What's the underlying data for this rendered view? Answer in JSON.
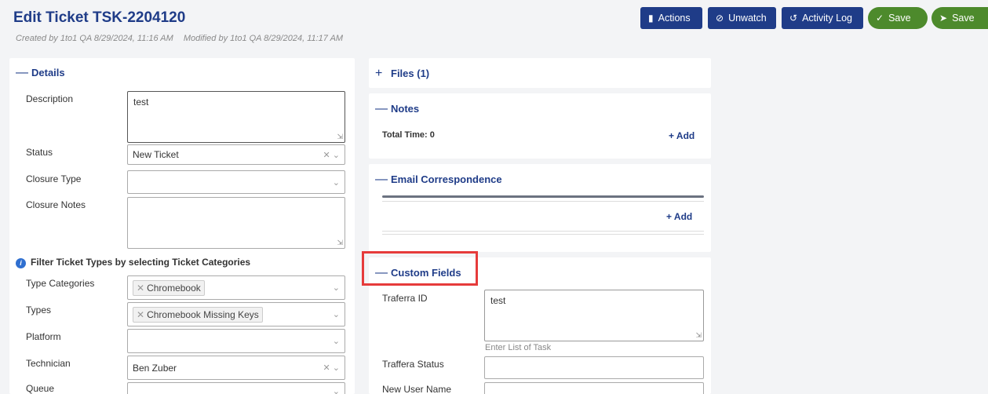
{
  "header": {
    "title": "Edit Ticket TSK-2204120",
    "created": "Created by 1to1 QA 8/29/2024, 11:16 AM",
    "modified": "Modified by 1to1 QA 8/29/2024, 11:17 AM"
  },
  "toolbar": {
    "actions": "Actions",
    "unwatch": "Unwatch",
    "activity_log": "Activity Log",
    "save": "Save",
    "save_send": "Save"
  },
  "details": {
    "heading": "Details",
    "description_label": "Description",
    "description_value": "test",
    "status_label": "Status",
    "status_value": "New Ticket",
    "closure_type_label": "Closure Type",
    "closure_notes_label": "Closure Notes",
    "filter_note": "Filter Ticket Types by selecting Ticket Categories",
    "type_categories_label": "Type Categories",
    "type_categories_tag": "Chromebook",
    "types_label": "Types",
    "types_tag": "Chromebook Missing Keys",
    "platform_label": "Platform",
    "technician_label": "Technician",
    "technician_value": "Ben Zuber",
    "queue_label": "Queue"
  },
  "files": {
    "heading": "Files (1)"
  },
  "notes": {
    "heading": "Notes",
    "total_time": "Total Time: 0",
    "add": "+ Add"
  },
  "email": {
    "heading": "Email Correspondence",
    "add": "+ Add"
  },
  "custom": {
    "heading": "Custom Fields",
    "traferra_id_label": "Traferra ID",
    "traferra_id_value": "test",
    "traferra_id_hint": "Enter List of Task",
    "traffera_status_label": "Traffera Status",
    "new_user_name_label": "New User Name"
  },
  "colors": {
    "primary": "#1f3c88",
    "success": "#4d8a2c",
    "highlight": "#e63b3b"
  }
}
